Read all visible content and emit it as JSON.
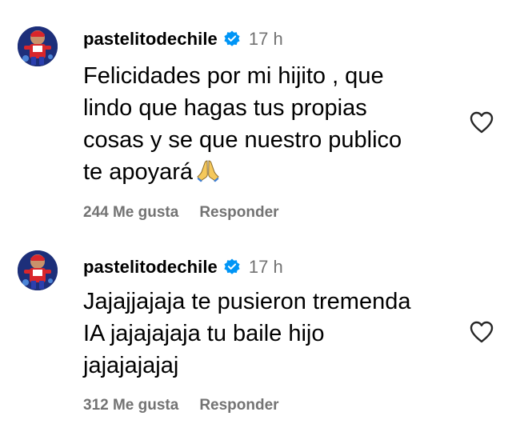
{
  "comments": [
    {
      "username": "pastelitodechile",
      "verified": true,
      "time": "17 h",
      "text_lines": [
        "Felicidades por mi hijito , que",
        "lindo que hagas tus propias",
        "cosas y se que nuestro publico",
        "te apoyará"
      ],
      "emoji": "folded-hands-icon",
      "likes": "244 Me gusta",
      "reply_label": "Responder"
    },
    {
      "username": "pastelitodechile",
      "verified": true,
      "time": "17 h",
      "text_lines": [
        "Jajajjajaja te pusieron tremenda",
        "IA jajajajaja tu baile hijo",
        "jajajajajaj"
      ],
      "likes": "312 Me gusta",
      "reply_label": "Responder"
    }
  ],
  "colors": {
    "verified_badge": "#0095f6",
    "secondary_text": "#737373",
    "primary_text": "#000000"
  }
}
